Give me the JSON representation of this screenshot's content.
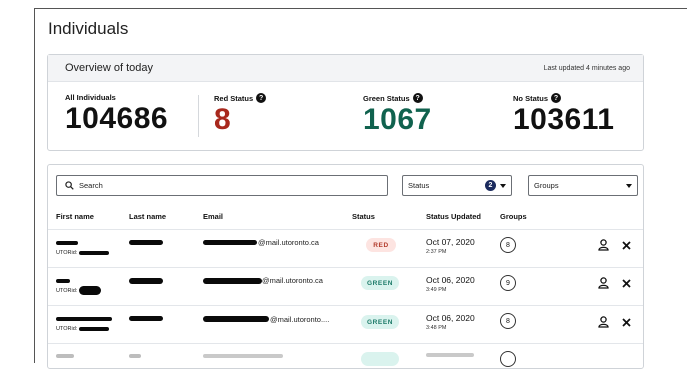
{
  "page": {
    "title": "Individuals"
  },
  "overview": {
    "title": "Overview of today",
    "last_updated": "Last updated 4 minutes ago",
    "stats": [
      {
        "label": "All Individuals",
        "value": "104686",
        "help": false,
        "color": "#111111"
      },
      {
        "label": "Red Status",
        "value": "8",
        "help": true,
        "color": "#a8281d"
      },
      {
        "label": "Green Status",
        "value": "1067",
        "help": true,
        "color": "#10624e"
      },
      {
        "label": "No Status",
        "value": "103611",
        "help": true,
        "color": "#111111"
      }
    ]
  },
  "filters": {
    "search_placeholder": "Search",
    "status_label": "Status",
    "status_count": "2",
    "groups_label": "Groups"
  },
  "table": {
    "columns": [
      "First name",
      "Last name",
      "Email",
      "Status",
      "Status Updated",
      "Groups"
    ],
    "rows": [
      {
        "utorid_label": "UTORid:",
        "email_suffix": "@mail.utoronto.ca",
        "status": "RED",
        "date": "Oct 07, 2020",
        "time": "2:37 PM",
        "groups": "8"
      },
      {
        "utorid_label": "UTORid:",
        "email_suffix": "@mail.utoronto.ca",
        "status": "GREEN",
        "date": "Oct 06, 2020",
        "time": "3:49 PM",
        "groups": "9"
      },
      {
        "utorid_label": "UTORid:",
        "email_suffix": "@mail.utoronto....",
        "status": "GREEN",
        "date": "Oct 06, 2020",
        "time": "3:48 PM",
        "groups": "8"
      }
    ]
  },
  "icons": {
    "search": "search-icon",
    "help": "help-icon",
    "dropdown": "chevron-down-icon",
    "user": "user-icon",
    "remove": "close-icon"
  }
}
